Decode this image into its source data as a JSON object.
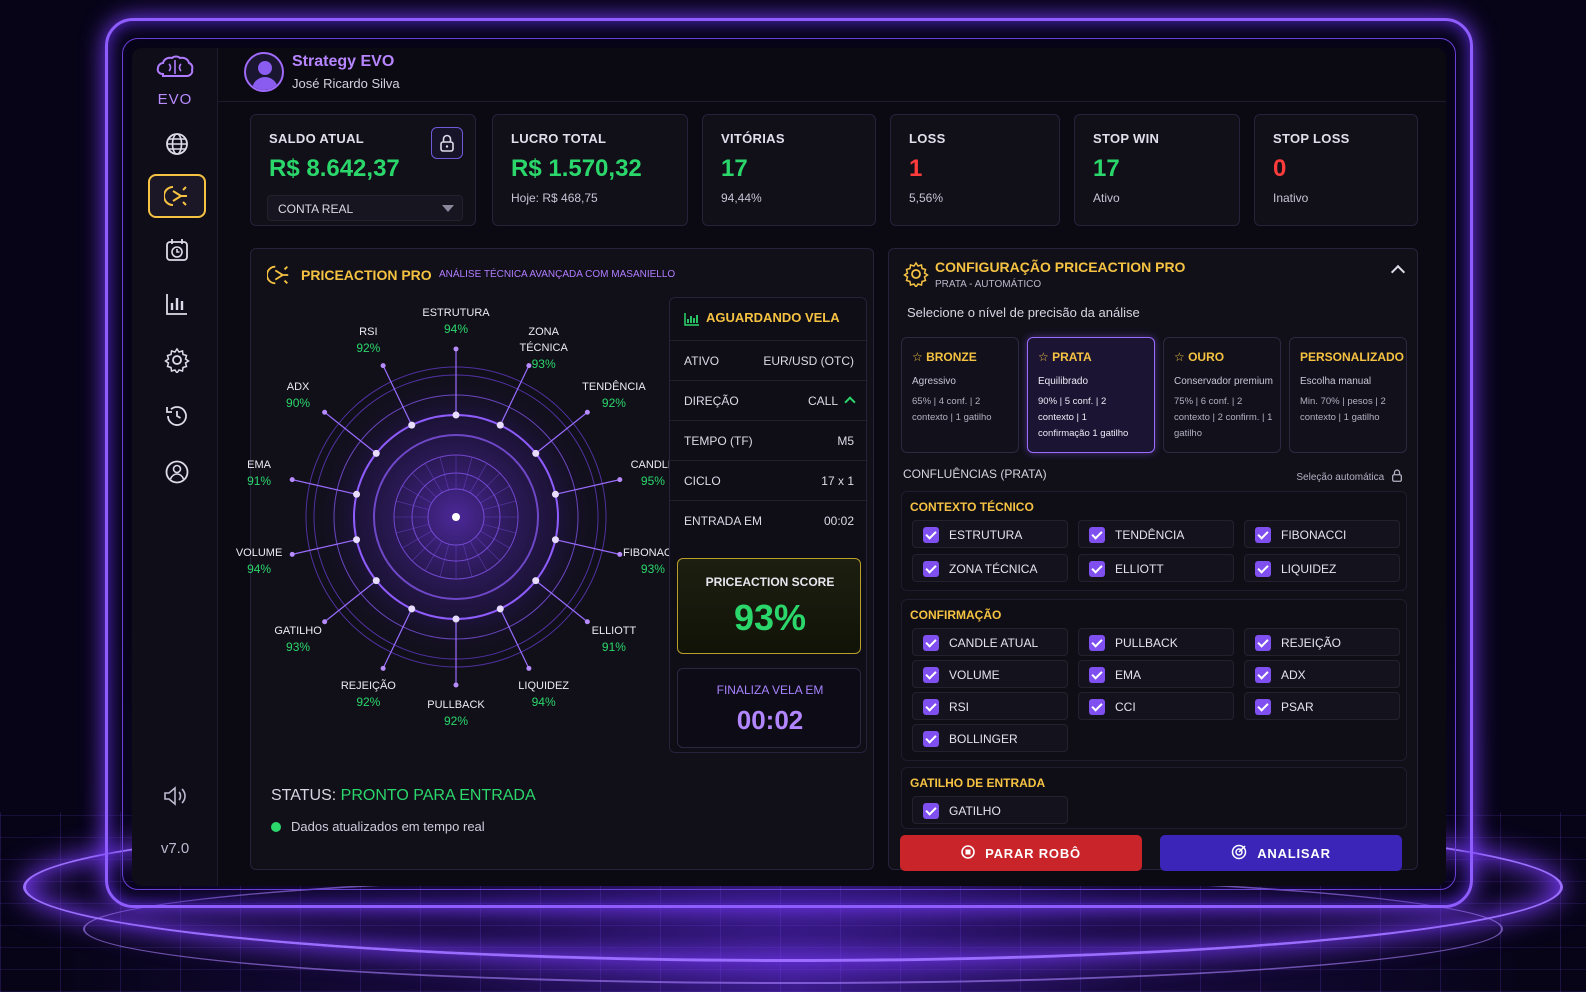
{
  "app": {
    "logo_text": "EVO",
    "version": "v7.0"
  },
  "header": {
    "title": "Strategy EVO",
    "user": "José Ricardo Silva"
  },
  "sidebar": {
    "items": [
      "globe-icon",
      "strategy-icon",
      "calendar-clock-icon",
      "bar-chart-icon",
      "settings-icon",
      "history-icon",
      "user-icon"
    ],
    "active": 1
  },
  "stats": {
    "saldo": {
      "label": "SALDO ATUAL",
      "value": "R$ 8.642,37",
      "account": "CONTA REAL"
    },
    "lucro": {
      "label": "LUCRO TOTAL",
      "value": "R$ 1.570,32",
      "sub": "Hoje: R$ 468,75"
    },
    "vitorias": {
      "label": "VITÓRIAS",
      "value": "17",
      "sub": "94,44%"
    },
    "loss": {
      "label": "LOSS",
      "value": "1",
      "sub": "5,56%"
    },
    "stopwin": {
      "label": "STOP WIN",
      "value": "17",
      "sub": "Ativo"
    },
    "stoploss": {
      "label": "STOP LOSS",
      "value": "0",
      "sub": "Inativo"
    }
  },
  "priceaction": {
    "title": "PRICEACTION PRO",
    "subtitle": "ANÁLISE TÉCNICA AVANÇADA COM MASANIELLO",
    "indicators": [
      {
        "name": "ESTRUTURA",
        "pct": "94%"
      },
      {
        "name": "ZONA TÉCNICA",
        "pct": "93%"
      },
      {
        "name": "TENDÊNCIA",
        "pct": "92%"
      },
      {
        "name": "CANDLE",
        "pct": "95%"
      },
      {
        "name": "FIBONACCI",
        "pct": "93%"
      },
      {
        "name": "ELLIOTT",
        "pct": "91%"
      },
      {
        "name": "LIQUIDEZ",
        "pct": "94%"
      },
      {
        "name": "PULLBACK",
        "pct": "92%"
      },
      {
        "name": "REJEIÇÃO",
        "pct": "92%"
      },
      {
        "name": "GATILHO",
        "pct": "93%"
      },
      {
        "name": "VOLUME",
        "pct": "94%"
      },
      {
        "name": "EMA",
        "pct": "91%"
      },
      {
        "name": "ADX",
        "pct": "90%"
      },
      {
        "name": "RSI",
        "pct": "92%"
      }
    ],
    "status_label": "STATUS:",
    "status_value": "PRONTO PARA ENTRADA",
    "live_text": "Dados atualizados em tempo real"
  },
  "signal": {
    "title": "AGUARDANDO VELA",
    "rows": [
      {
        "k": "ATIVO",
        "v": "EUR/USD (OTC)"
      },
      {
        "k": "DIREÇÃO",
        "v": "CALL"
      },
      {
        "k": "TEMPO (TF)",
        "v": "M5"
      },
      {
        "k": "CICLO",
        "v": "17 x 1"
      },
      {
        "k": "ENTRADA EM",
        "v": "00:02"
      }
    ],
    "score_label": "PRICEACTION SCORE",
    "score_value": "93%",
    "finaliza_label": "FINALIZA VELA EM",
    "finaliza_value": "00:02"
  },
  "config": {
    "title": "CONFIGURAÇÃO PRICEACTION PRO",
    "subtitle": "PRATA - AUTOMÁTICO",
    "prompt": "Selecione o nível de precisão da análise",
    "levels": [
      {
        "name": "BRONZE",
        "desc": "Agressivo",
        "detail": "65% | 4 conf. | 2 contexto | 1 gatilho"
      },
      {
        "name": "PRATA",
        "desc": "Equilibrado",
        "detail": "90% | 5 conf. | 2 contexto | 1 confirmação 1 gatilho"
      },
      {
        "name": "OURO",
        "desc": "Conservador premium",
        "detail": "75% | 6 conf. | 2 contexto | 2 confirm. | 1 gatilho"
      },
      {
        "name": "PERSONALIZADO",
        "desc": "Escolha manual",
        "detail": "Min. 70% | pesos | 2 contexto | 1 gatilho"
      }
    ],
    "selected_level": 1,
    "confluences_label": "CONFLUÊNCIAS (PRATA)",
    "auto_label": "Seleção automática",
    "groups": [
      {
        "title": "CONTEXTO TÉCNICO",
        "items": [
          "ESTRUTURA",
          "TENDÊNCIA",
          "FIBONACCI",
          "ZONA TÉCNICA",
          "ELLIOTT",
          "LIQUIDEZ"
        ]
      },
      {
        "title": "CONFIRMAÇÃO",
        "items": [
          "CANDLE ATUAL",
          "PULLBACK",
          "REJEIÇÃO",
          "VOLUME",
          "EMA",
          "ADX",
          "RSI",
          "CCI",
          "PSAR",
          "BOLLINGER"
        ]
      },
      {
        "title": "GATILHO DE ENTRADA",
        "items": [
          "GATILHO"
        ]
      }
    ],
    "stop_button": "PARAR ROBÔ",
    "analyze_button": "ANALISAR"
  },
  "colors": {
    "accent": "#f5c242",
    "purple": "#8a5cf0",
    "green": "#2bd66b",
    "red": "#ff3b3b",
    "stop_btn": "#c8242a",
    "analyze_btn": "#3a25b8"
  }
}
